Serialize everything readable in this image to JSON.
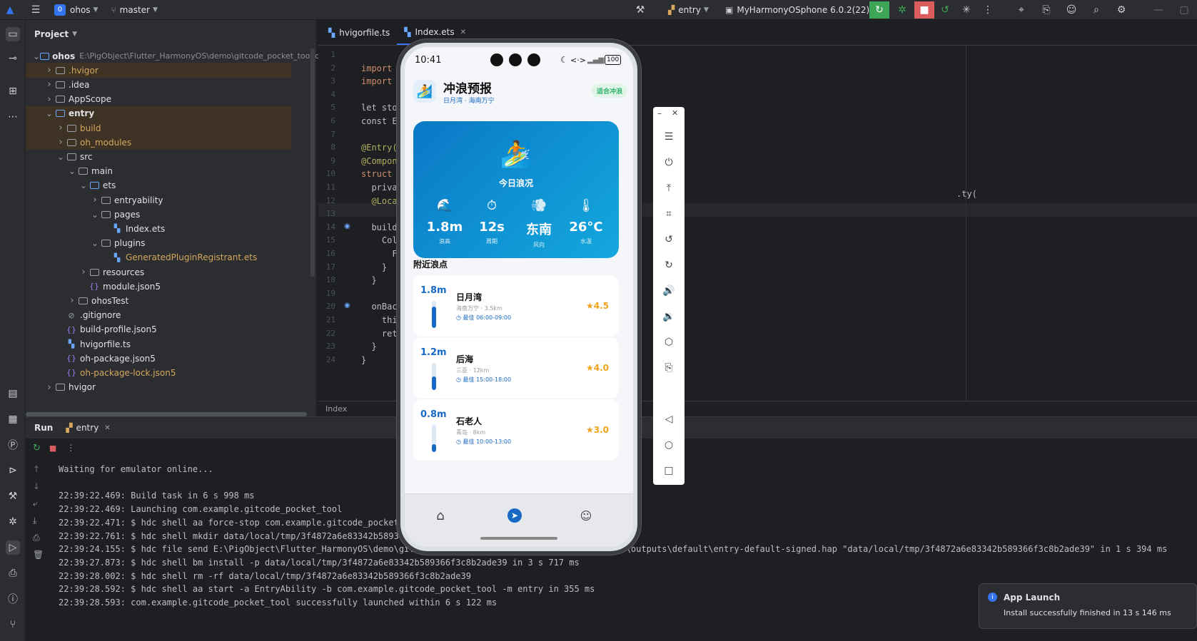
{
  "titlebar": {
    "project_badge": "0",
    "project_name": "ohos",
    "branch": "master",
    "run_config": "entry",
    "device": "MyHarmonyOSphone 6.0.2(22)"
  },
  "project_pane": {
    "title": "Project",
    "tree": [
      {
        "label": "ohos",
        "path": "E:\\PigObject\\Flutter_HarmonyOS\\demo\\gitcode_pocket_tool\\oh",
        "depth": 0,
        "type": "module",
        "open": true,
        "bold": true
      },
      {
        "label": ".hvigor",
        "depth": 1,
        "type": "folder",
        "orange": true
      },
      {
        "label": ".idea",
        "depth": 1,
        "type": "folder"
      },
      {
        "label": "AppScope",
        "depth": 1,
        "type": "folder"
      },
      {
        "label": "entry",
        "depth": 1,
        "type": "module",
        "open": true,
        "bold": true
      },
      {
        "label": "build",
        "depth": 2,
        "type": "folder",
        "orange": true
      },
      {
        "label": "oh_modules",
        "depth": 2,
        "type": "folder",
        "orange": true
      },
      {
        "label": "src",
        "depth": 2,
        "type": "folder",
        "open": true
      },
      {
        "label": "main",
        "depth": 3,
        "type": "folder",
        "open": true
      },
      {
        "label": "ets",
        "depth": 4,
        "type": "folder-blue",
        "open": true
      },
      {
        "label": "entryability",
        "depth": 5,
        "type": "folder"
      },
      {
        "label": "pages",
        "depth": 5,
        "type": "folder",
        "open": true
      },
      {
        "label": "Index.ets",
        "depth": 6,
        "type": "file-ets"
      },
      {
        "label": "plugins",
        "depth": 5,
        "type": "folder",
        "open": true
      },
      {
        "label": "GeneratedPluginRegistrant.ets",
        "depth": 6,
        "type": "file-ets",
        "orange": true
      },
      {
        "label": "resources",
        "depth": 4,
        "type": "folder"
      },
      {
        "label": "module.json5",
        "depth": 4,
        "type": "file-json"
      },
      {
        "label": "ohosTest",
        "depth": 3,
        "type": "folder"
      },
      {
        "label": ".gitignore",
        "depth": 2,
        "type": "file-ignore"
      },
      {
        "label": "build-profile.json5",
        "depth": 2,
        "type": "file-json"
      },
      {
        "label": "hvigorfile.ts",
        "depth": 2,
        "type": "file-ts"
      },
      {
        "label": "oh-package.json5",
        "depth": 2,
        "type": "file-json"
      },
      {
        "label": "oh-package-lock.json5",
        "depth": 2,
        "type": "file-json",
        "orange": true
      },
      {
        "label": "hvigor",
        "depth": 1,
        "type": "folder"
      }
    ]
  },
  "editor": {
    "tabs": [
      {
        "label": "hvigorfile.ts",
        "active": false
      },
      {
        "label": "Index.ets",
        "active": true
      }
    ],
    "lines": [
      {
        "n": "1",
        "text": ""
      },
      {
        "n": "2",
        "text": "import",
        "cls": "kw"
      },
      {
        "n": "3",
        "text": "import",
        "cls": "kw"
      },
      {
        "n": "4",
        "text": ""
      },
      {
        "n": "5",
        "text": "let sto"
      },
      {
        "n": "6",
        "text": "const E"
      },
      {
        "n": "7",
        "text": ""
      },
      {
        "n": "8",
        "text": "@Entry(",
        "cls": "dec"
      },
      {
        "n": "9",
        "text": "@Compon",
        "cls": "dec"
      },
      {
        "n": "10",
        "text": "struct",
        "cls": "kw"
      },
      {
        "n": "11",
        "text": "  priva"
      },
      {
        "n": "12",
        "text": "  @Loca",
        "cls": "dec"
      },
      {
        "n": "13",
        "text": ""
      },
      {
        "n": "14",
        "text": "  build"
      },
      {
        "n": "15",
        "text": "    Col"
      },
      {
        "n": "16",
        "text": "      F"
      },
      {
        "n": "17",
        "text": "    }"
      },
      {
        "n": "18",
        "text": "  }"
      },
      {
        "n": "19",
        "text": ""
      },
      {
        "n": "20",
        "text": "  onBac"
      },
      {
        "n": "21",
        "text": "    thi"
      },
      {
        "n": "22",
        "text": "    ret"
      },
      {
        "n": "23",
        "text": "  }"
      },
      {
        "n": "24",
        "text": "}"
      }
    ],
    "side_fragment": ".ty(",
    "breadcrumb": "Index"
  },
  "run_pane": {
    "title": "Run",
    "tab": "entry",
    "console": [
      "Waiting for emulator online...",
      "",
      "22:39:22.469: Build task in 6 s 998 ms",
      "22:39:22.469: Launching com.example.gitcode_pocket_tool",
      "22:39:22.471: $ hdc shell aa force-stop com.example.gitcode_pocket_",
      "22:39:22.761: $ hdc shell mkdir data/local/tmp/3f4872a6e83342b589366",
      "22:39:24.155: $ hdc file send E:\\PigObject\\Flutter_HarmonyOS\\demo\\gitcode_pocket_tool\\ohos\\entry\\build\\default\\outputs\\default\\entry-default-signed.hap \"data/local/tmp/3f4872a6e83342b589366f3c8b2ade39\" in 1 s 394 ms",
      "22:39:27.873: $ hdc shell bm install -p data/local/tmp/3f4872a6e83342b589366f3c8b2ade39 in 3 s 717 ms",
      "22:39:28.002: $ hdc shell rm -rf data/local/tmp/3f4872a6e83342b589366f3c8b2ade39",
      "22:39:28.592: $ hdc shell aa start -a EntryAbility -b com.example.gitcode_pocket_tool -m entry in 355 ms",
      "22:39:28.593: com.example.gitcode_pocket_tool successfully launched within 6 s 122 ms"
    ]
  },
  "phone": {
    "status_time": "10:41",
    "battery": "100",
    "app_title": "冲浪预报",
    "app_subtitle": "日月湾 · 海南万宁",
    "app_badge": "适合冲浪",
    "hero_title": "今日浪况",
    "stats": [
      {
        "icon": "wave-icon",
        "glyph": "🌊",
        "value": "1.8m",
        "label": "浪高"
      },
      {
        "icon": "timer-icon",
        "glyph": "⏱",
        "value": "12s",
        "label": "周期"
      },
      {
        "icon": "wind-icon",
        "glyph": "💨",
        "value": "东南",
        "label": "风向"
      },
      {
        "icon": "thermometer-icon",
        "glyph": "🌡",
        "value": "26°C",
        "label": "水温"
      }
    ],
    "nearby_title": "附近浪点",
    "spots": [
      {
        "height": "1.8m",
        "name": "日月湾",
        "sub": "海南万宁 · 3.5km",
        "best": "最佳 06:00-09:00",
        "rating": "4.5",
        "level": 0.8
      },
      {
        "height": "1.2m",
        "name": "后海",
        "sub": "三亚 · 12km",
        "best": "最佳 15:00-18:00",
        "rating": "4.0",
        "level": 0.5
      },
      {
        "height": "0.8m",
        "name": "石老人",
        "sub": "青岛 · 8km",
        "best": "最佳 10:00-13:00",
        "rating": "3.0",
        "level": 0.3
      }
    ]
  },
  "notification": {
    "title": "App Launch",
    "body": "Install successfully finished in 13 s 146 ms"
  },
  "colors": {
    "accent": "#3574f0",
    "hero_start": "#0a78c6",
    "hero_end": "#14a8dd",
    "badge_green": "#2fb36b",
    "star": "#f0a31a",
    "stop_red": "#db5c5c",
    "run_green": "#3fa556"
  }
}
